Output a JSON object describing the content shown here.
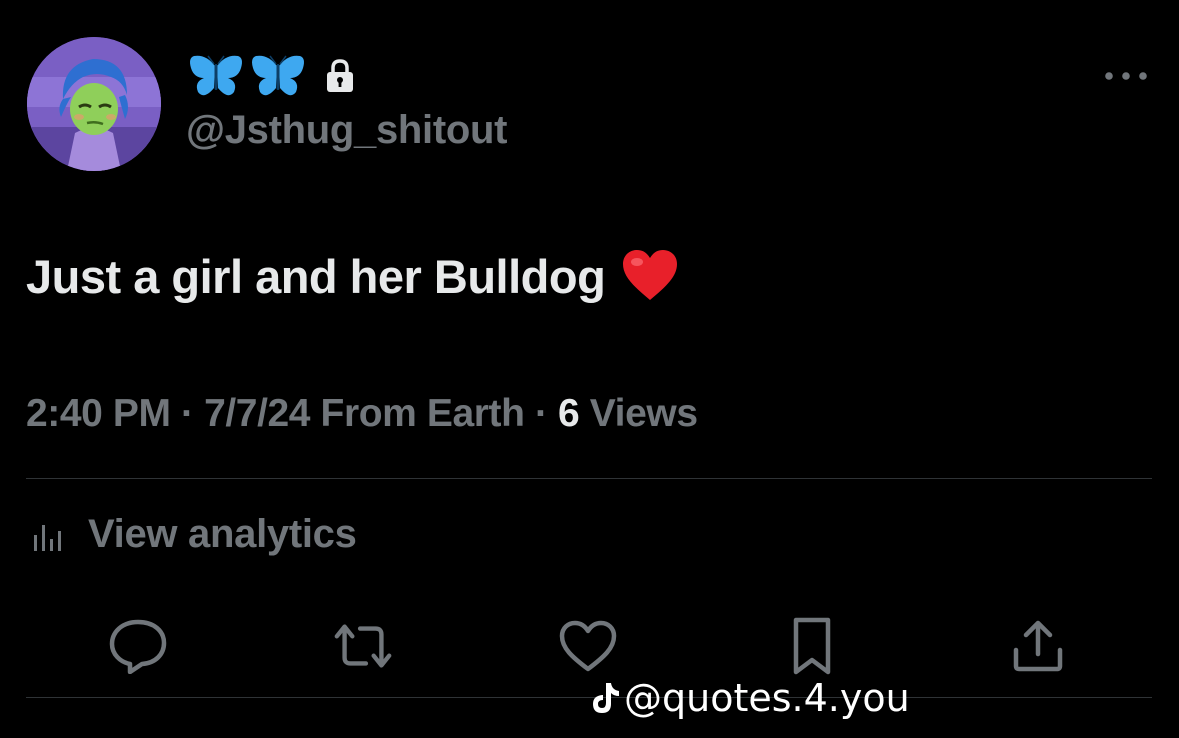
{
  "tweet": {
    "display_name_icons": [
      "butterfly-icon",
      "butterfly-icon",
      "lock-icon"
    ],
    "handle": "@Jsthug_shitout",
    "text": "Just a girl and her Bulldog",
    "text_emoji": "red-heart-icon",
    "time": "2:40 PM",
    "sep1": " · ",
    "date": "7/7/24",
    "source": " From Earth",
    "sep2": " · ",
    "views_count": "6",
    "views_label": " Views",
    "analytics_label": "View analytics"
  },
  "actions": [
    "reply-icon",
    "retweet-icon",
    "like-icon",
    "bookmark-icon",
    "share-icon"
  ],
  "watermark": {
    "icon": "tiktok-icon",
    "text": "@quotes.4.you"
  },
  "colors": {
    "background": "#000000",
    "primary_text": "#e7e9ea",
    "secondary_text": "#71767b",
    "divider": "#2f3336",
    "butterfly": "#3ea8f0",
    "heart": "#e8202a"
  }
}
